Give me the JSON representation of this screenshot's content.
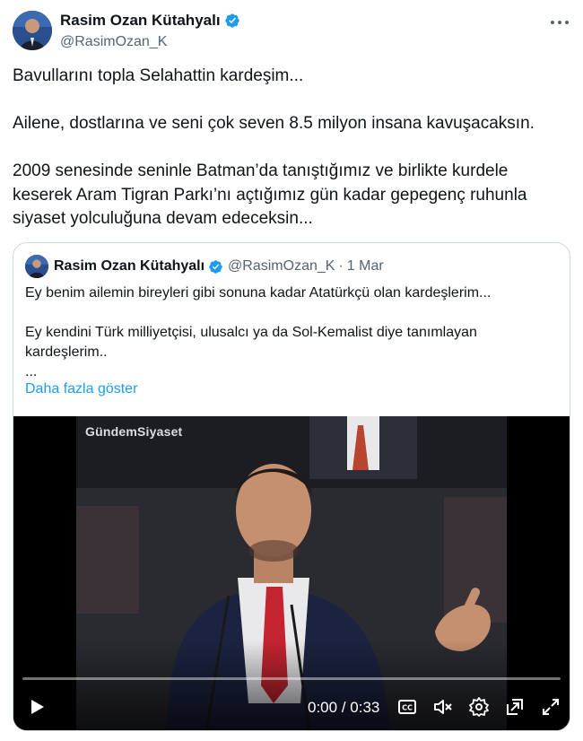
{
  "author": {
    "display_name": "Rasim Ozan Kütahyalı",
    "handle": "@RasimOzan_K",
    "verified_icon": "verified-badge-icon"
  },
  "tweet": {
    "paragraphs": [
      "Bavullarını topla Selahattin kardeşim...",
      "Ailene, dostlarına ve seni çok seven 8.5 milyon insana kavuşacaksın.",
      "2009 senesinde seninle Batman’da tanıştığımız ve birlikte kurdele\nkeserek Aram Tigran Parkı’nı açtığımız gün kadar gepegenç ruhunla\nsiyaset yolculuğuna devam edeceksin..."
    ]
  },
  "quote": {
    "display_name": "Rasim Ozan Kütahyalı",
    "handle": "@RasimOzan_K",
    "separator": "·",
    "date": "1 Mar",
    "lines": [
      "Ey benim ailemin bireyleri gibi sonuna kadar Atatürkçü olan kardeşlerim...",
      "Ey kendini Türk milliyetçisi, ulusalcı ya da Sol-Kemalist diye tanımlayan",
      "kardeşlerim..",
      "..."
    ],
    "show_more": "Daha fazla göster",
    "video": {
      "watermark": "GündemSiyaset",
      "current_time": "0:00",
      "time_separator": "/",
      "duration": "0:33",
      "progress": 0
    }
  },
  "colors": {
    "link": "#1d9bf0",
    "verified": "#1d9bf0",
    "secondary_text": "#536471",
    "border": "#cfd9de"
  }
}
